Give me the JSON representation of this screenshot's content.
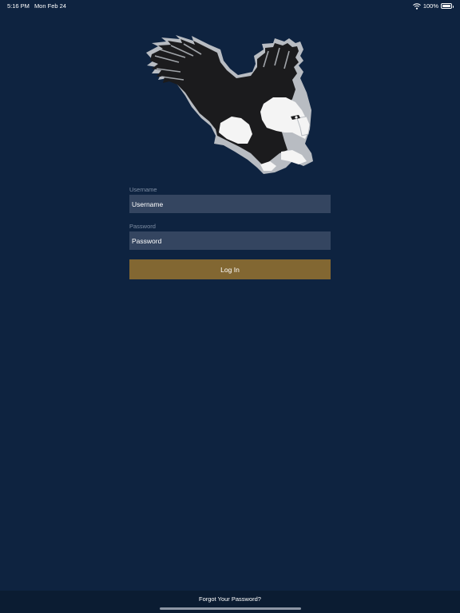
{
  "status_bar": {
    "time": "5:16 PM",
    "date": "Mon Feb 24",
    "battery": "100%",
    "wifi_icon": "wifi-icon",
    "battery_icon": "battery-icon"
  },
  "logo": {
    "icon": "eagle-logo"
  },
  "form": {
    "username_label": "Username",
    "username_placeholder": "Username",
    "username_value": "",
    "password_label": "Password",
    "password_placeholder": "Password",
    "password_value": "",
    "login_label": "Log In"
  },
  "footer": {
    "forgot_label": "Forgot Your Password?"
  },
  "colors": {
    "background": "#0e2340",
    "input": "#344560",
    "button": "#826732",
    "label": "#7e8da3"
  }
}
